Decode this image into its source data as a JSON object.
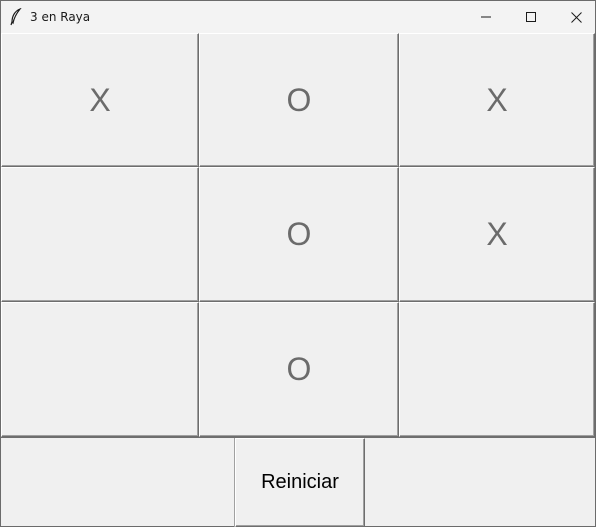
{
  "window": {
    "title": "3 en Raya",
    "icon": "feather-icon",
    "controls": [
      "minimize-icon",
      "maximize-icon",
      "close-icon"
    ]
  },
  "board": {
    "rows": [
      [
        "X",
        "O",
        "X"
      ],
      [
        "",
        "O",
        "X"
      ],
      [
        "",
        "O",
        ""
      ]
    ]
  },
  "reset_button": {
    "label": "Reiniciar"
  },
  "colors": {
    "mark": "#6b6b6b",
    "background": "#f0f0f0"
  }
}
